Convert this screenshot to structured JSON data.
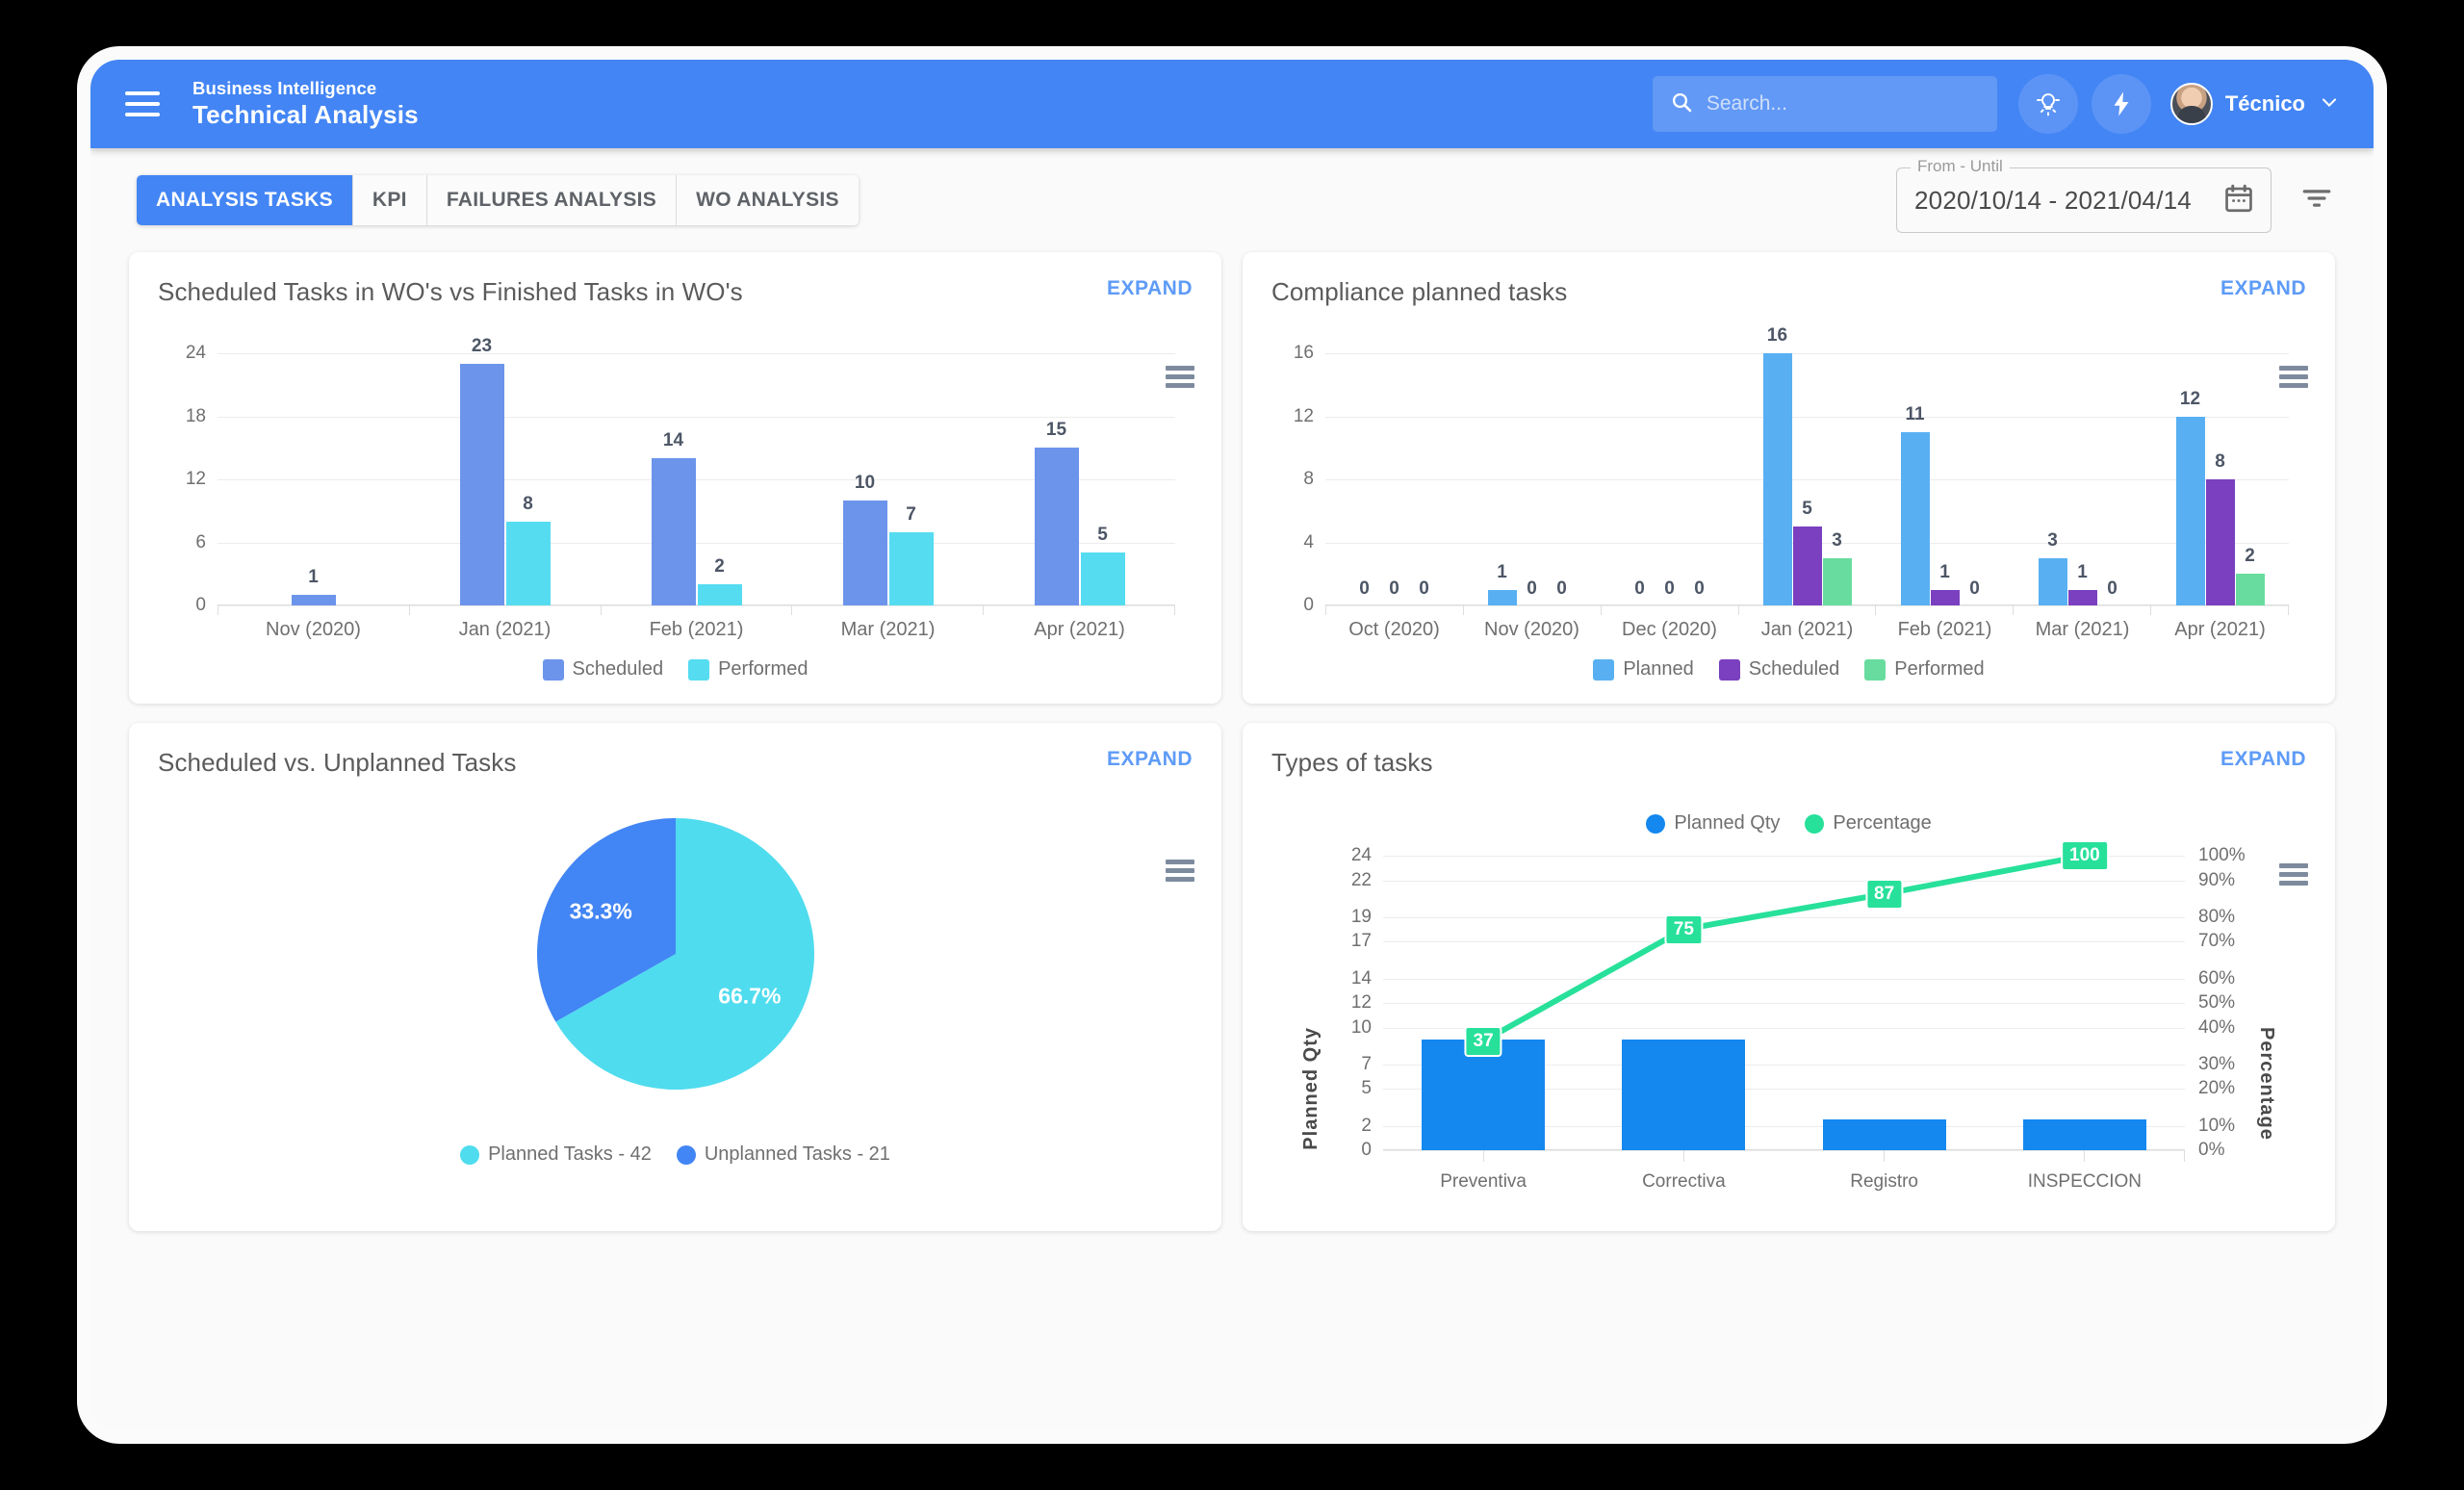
{
  "header": {
    "menu_icon": "hamburger-icon",
    "brand_sub": "Business Intelligence",
    "brand_main": "Technical Analysis",
    "search_placeholder": "Search...",
    "search_value": "",
    "search_icon": "search-icon",
    "theme_icon": "lightbulb-icon",
    "quick_icon": "lightning-bolt-icon",
    "user_name": "Técnico",
    "user_chevron": "chevron-down-icon",
    "bar_color": "#4385f4"
  },
  "toolbar": {
    "tabs": [
      {
        "label": "ANALYSIS TASKS",
        "active": true
      },
      {
        "label": "KPI",
        "active": false
      },
      {
        "label": "FAILURES ANALYSIS",
        "active": false
      },
      {
        "label": "WO ANALYSIS",
        "active": false
      }
    ],
    "date_range": {
      "legend": "From - Until",
      "value": "2020/10/14 - 2021/04/14",
      "calendar_icon": "calendar-icon"
    },
    "filter_icon": "filter-icon"
  },
  "cards": [
    {
      "title": "Scheduled Tasks in WO's vs Finished Tasks in WO's",
      "expand_label": "EXPAND",
      "menu_icon": "chart-context-menu-icon"
    },
    {
      "title": "Compliance planned tasks",
      "expand_label": "EXPAND",
      "menu_icon": "chart-context-menu-icon"
    },
    {
      "title": "Scheduled vs. Unplanned Tasks",
      "expand_label": "EXPAND",
      "menu_icon": "chart-context-menu-icon"
    },
    {
      "title": "Types of tasks",
      "expand_label": "EXPAND",
      "menu_icon": "chart-context-menu-icon"
    }
  ],
  "chart_data": [
    {
      "id": "scheduled-vs-finished",
      "type": "bar",
      "title": "Scheduled Tasks in WO's vs Finished Tasks in WO's",
      "categories": [
        "Nov (2020)",
        "Jan (2021)",
        "Feb (2021)",
        "Mar (2021)",
        "Apr (2021)"
      ],
      "series": [
        {
          "name": "Scheduled",
          "color": "#6c94eb",
          "values": [
            1,
            23,
            14,
            10,
            15
          ]
        },
        {
          "name": "Performed",
          "color": "#55dcf0",
          "values": [
            null,
            8,
            2,
            7,
            5
          ]
        }
      ],
      "yticks": [
        0,
        6,
        12,
        18,
        24
      ],
      "ylim": [
        0,
        24
      ],
      "xlabel": "",
      "ylabel": "",
      "grid": true,
      "legend_position": "bottom"
    },
    {
      "id": "compliance-planned-tasks",
      "type": "bar",
      "title": "Compliance planned tasks",
      "categories": [
        "Oct (2020)",
        "Nov (2020)",
        "Dec (2020)",
        "Jan (2021)",
        "Feb (2021)",
        "Mar (2021)",
        "Apr (2021)"
      ],
      "series": [
        {
          "name": "Planned",
          "color": "#58b0f2",
          "values": [
            0,
            1,
            0,
            16,
            11,
            3,
            12
          ]
        },
        {
          "name": "Scheduled",
          "color": "#7a40bf",
          "values": [
            0,
            0,
            0,
            5,
            1,
            1,
            8
          ]
        },
        {
          "name": "Performed",
          "color": "#68dc9f",
          "values": [
            0,
            0,
            0,
            3,
            0,
            0,
            2
          ]
        }
      ],
      "yticks": [
        0,
        4,
        8,
        12,
        16
      ],
      "ylim": [
        0,
        16
      ],
      "xlabel": "",
      "ylabel": "",
      "grid": true,
      "legend_position": "bottom"
    },
    {
      "id": "scheduled-vs-unplanned",
      "type": "pie",
      "title": "Scheduled vs. Unplanned Tasks",
      "slices": [
        {
          "name": "Planned Tasks",
          "value": 42,
          "percent": "66.7%",
          "color": "#4fdcee",
          "legend": "Planned Tasks - 42"
        },
        {
          "name": "Unplanned Tasks",
          "value": 21,
          "percent": "33.3%",
          "color": "#4285f4",
          "legend": "Unplanned Tasks - 21"
        }
      ],
      "legend_position": "bottom"
    },
    {
      "id": "types-of-tasks",
      "type": "bar",
      "title": "Types of tasks",
      "categories": [
        "Preventiva",
        "Correctiva",
        "Registro",
        "INSPECCION"
      ],
      "series": [
        {
          "name": "Planned Qty",
          "color": "#1488ef",
          "values": [
            9,
            9,
            2.5,
            2.5
          ]
        },
        {
          "name": "Percentage",
          "color": "#27e09a",
          "values": [
            37,
            75,
            87,
            100
          ],
          "kind": "line",
          "labels": [
            "37",
            "75",
            "87",
            "100"
          ]
        }
      ],
      "yticks": [
        0,
        2,
        5,
        7,
        10,
        12,
        14,
        17,
        19,
        22,
        24
      ],
      "ylim": [
        0,
        24
      ],
      "y2ticks": [
        "0%",
        "10%",
        "20%",
        "30%",
        "40%",
        "50%",
        "60%",
        "70%",
        "80%",
        "90%",
        "100%"
      ],
      "y2lim": [
        0,
        100
      ],
      "ylabel": "Planned  Qty",
      "y2label": "Percentage",
      "xlabel": "",
      "grid": true,
      "legend_position": "top"
    }
  ]
}
